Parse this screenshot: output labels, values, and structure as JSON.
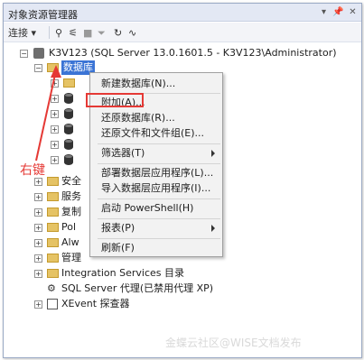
{
  "window": {
    "title": "对象资源管理器",
    "controls": [
      "▾",
      "📌",
      "✕"
    ]
  },
  "toolbar": {
    "connect_label": "连接",
    "icons": [
      "connect-dropdown-icon",
      "plug-icon",
      "disconnect-icon",
      "stop-icon",
      "filter-icon",
      "refresh-icon",
      "activity-icon"
    ]
  },
  "tree": {
    "server": "K3V123 (SQL Server 13.0.1601.5 - K3V123\\Administrator)",
    "databases_label": "数据库",
    "partial_labels": [
      "安全",
      "服务",
      "复制",
      "Pol",
      "Alw",
      "管理"
    ],
    "integration_services": "Integration Services 目录",
    "sql_agent": "SQL Server 代理(已禁用代理 XP)",
    "xevent": "XEvent 探查器"
  },
  "context_menu": {
    "items": [
      "新建数据库(N)...",
      "附加(A)...",
      "还原数据库(R)...",
      "还原文件和文件组(E)...",
      "筛选器(T)",
      "部署数据层应用程序(L)...",
      "导入数据层应用程序(I)...",
      "启动 PowerShell(H)",
      "报表(P)",
      "刷新(F)"
    ]
  },
  "annotation": {
    "label": "右键",
    "color": "#e53935"
  },
  "watermark": "金蝶云社区@WISE文档发布"
}
